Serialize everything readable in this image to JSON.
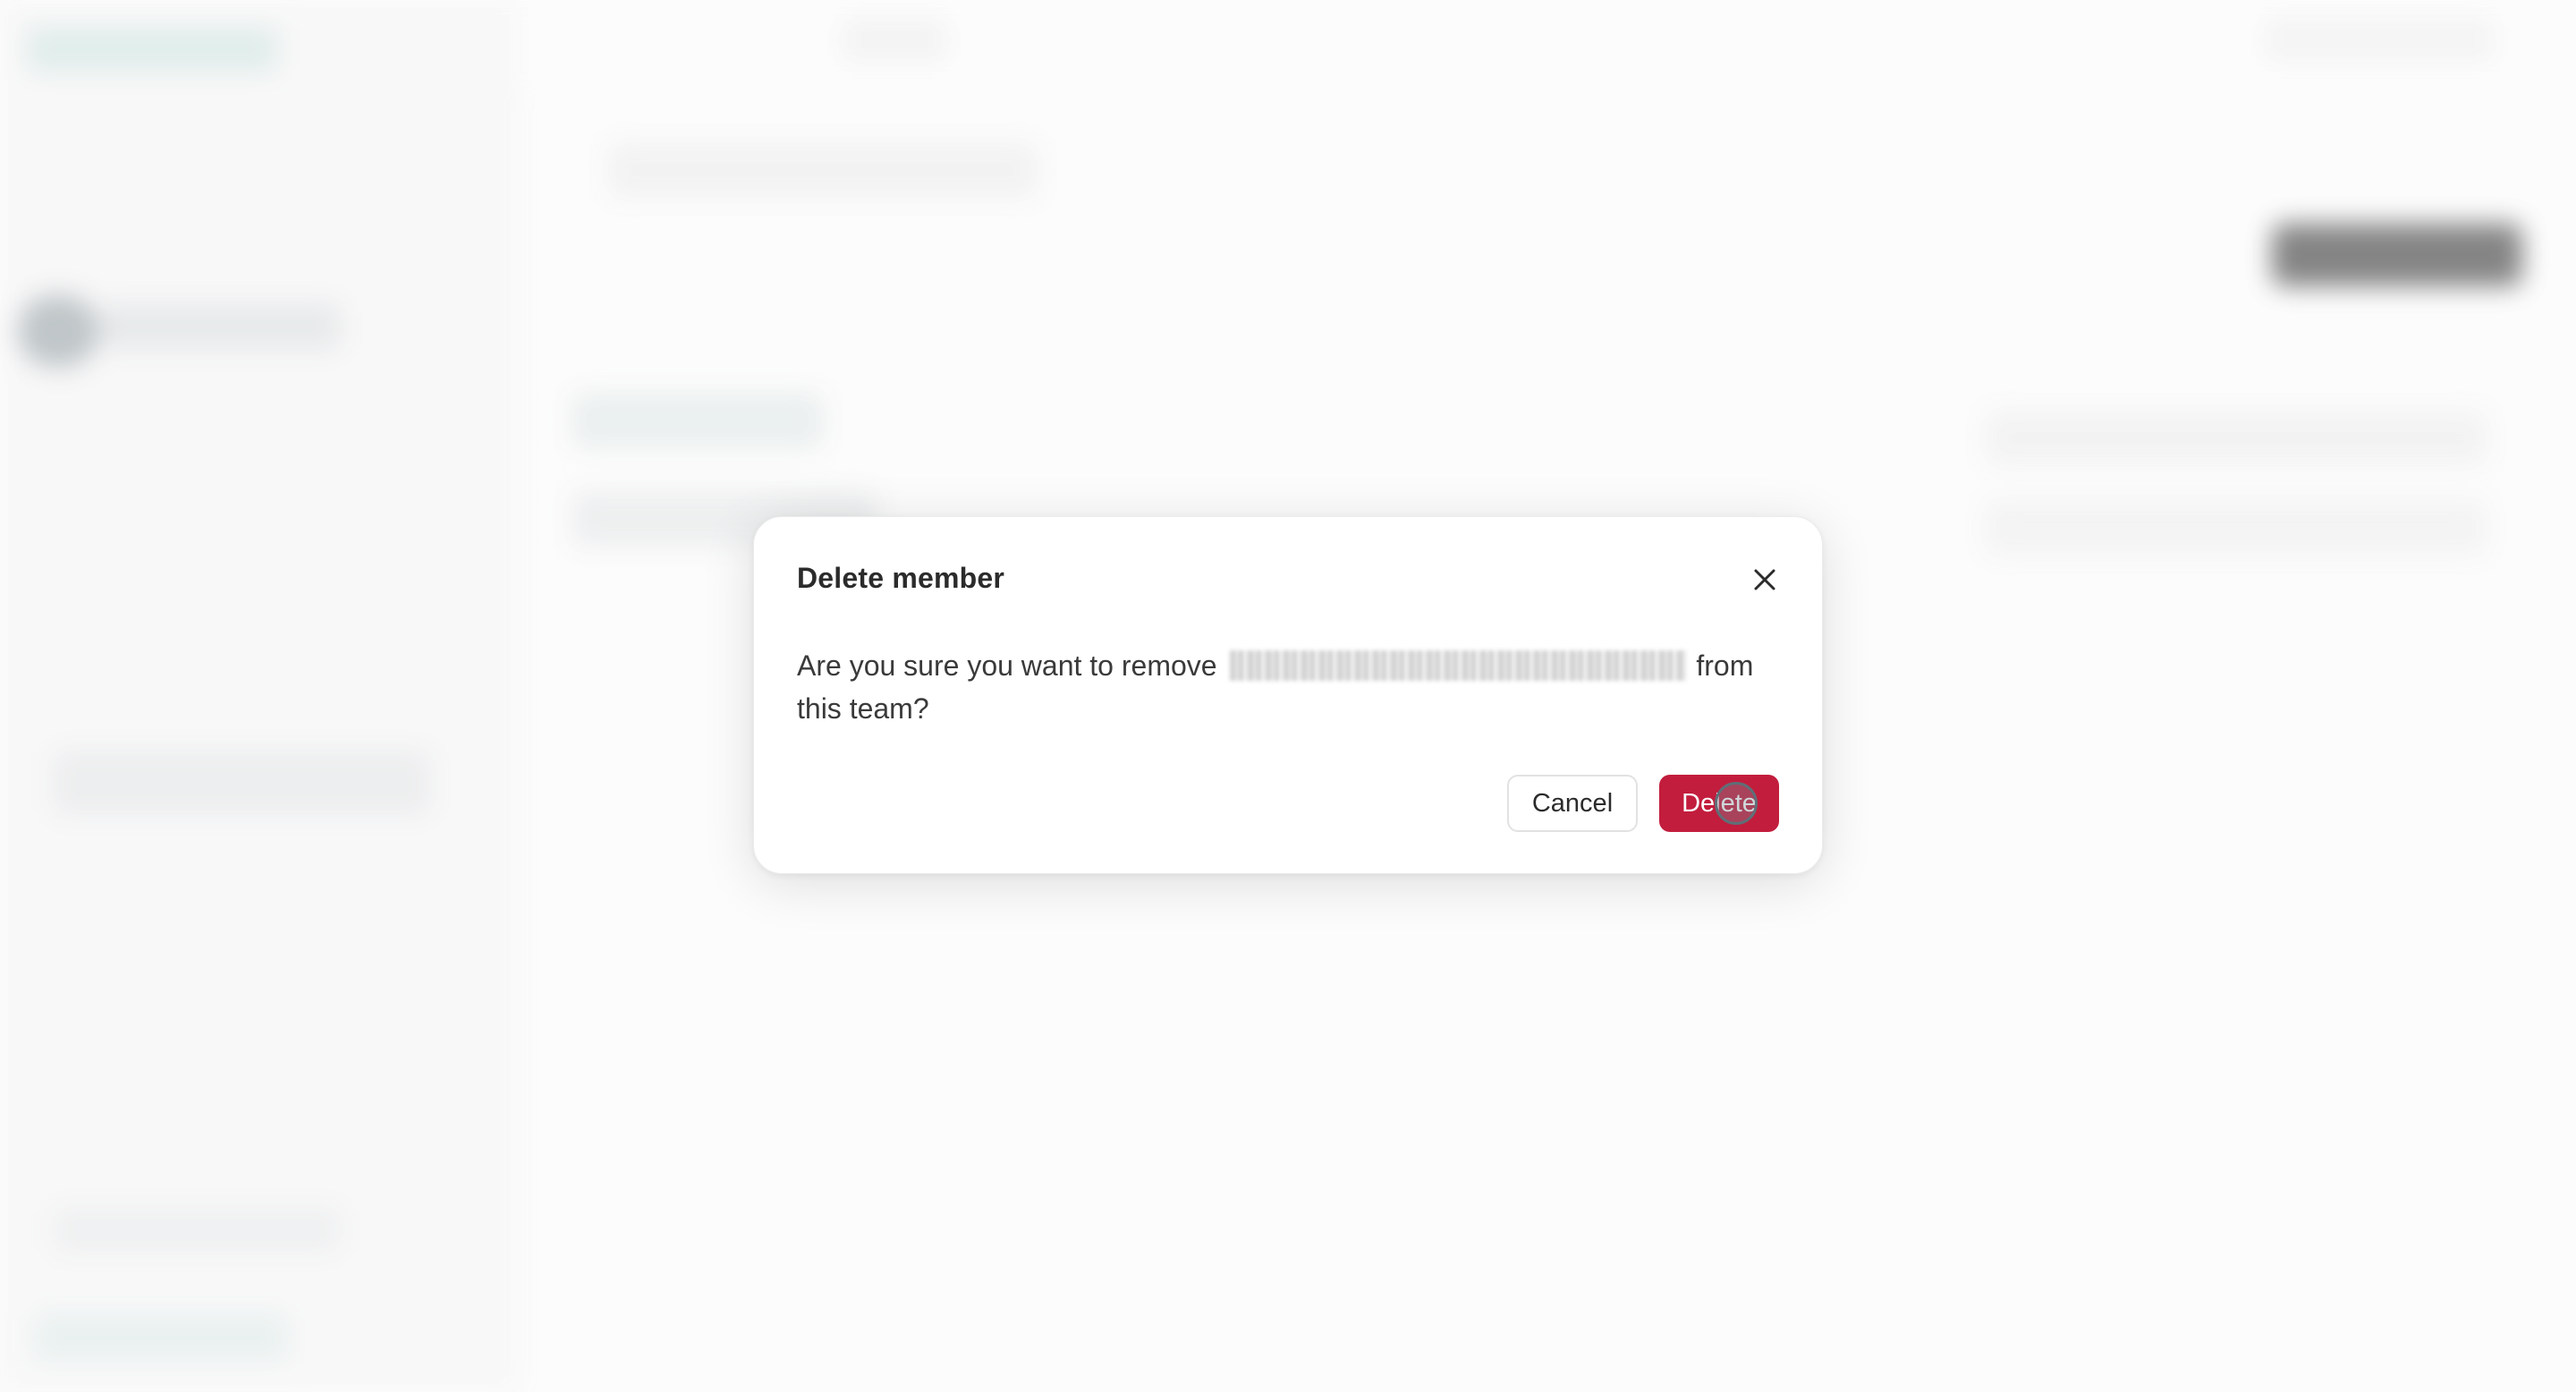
{
  "dialog": {
    "title": "Delete member",
    "message_prefix": "Are you sure you want to remove ",
    "message_suffix": " from this team?",
    "cancel_label": "Cancel",
    "delete_label": "Delete",
    "close_icon": "close-icon"
  },
  "colors": {
    "danger": "#c21d3d",
    "dialog_bg": "#ffffff",
    "text": "#2b2b2b"
  }
}
